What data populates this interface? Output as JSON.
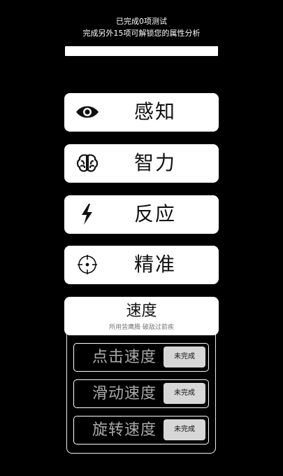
{
  "header": {
    "line1": "已完成0项测试",
    "line2": "完成另外15项可解锁您的属性分析",
    "progress": 0
  },
  "categories": [
    {
      "label": "感知",
      "icon": "eye-icon"
    },
    {
      "label": "智力",
      "icon": "brain-icon"
    },
    {
      "label": "反应",
      "icon": "lightning-icon"
    },
    {
      "label": "精准",
      "icon": "crosshair-icon"
    }
  ],
  "speed": {
    "title": "速度",
    "subtitle": "所用皆鹰腾 破敌过箭疾",
    "items": [
      {
        "label": "点击速度",
        "status": "未完成"
      },
      {
        "label": "滑动速度",
        "status": "未完成"
      },
      {
        "label": "旋转速度",
        "status": "未完成"
      }
    ]
  }
}
